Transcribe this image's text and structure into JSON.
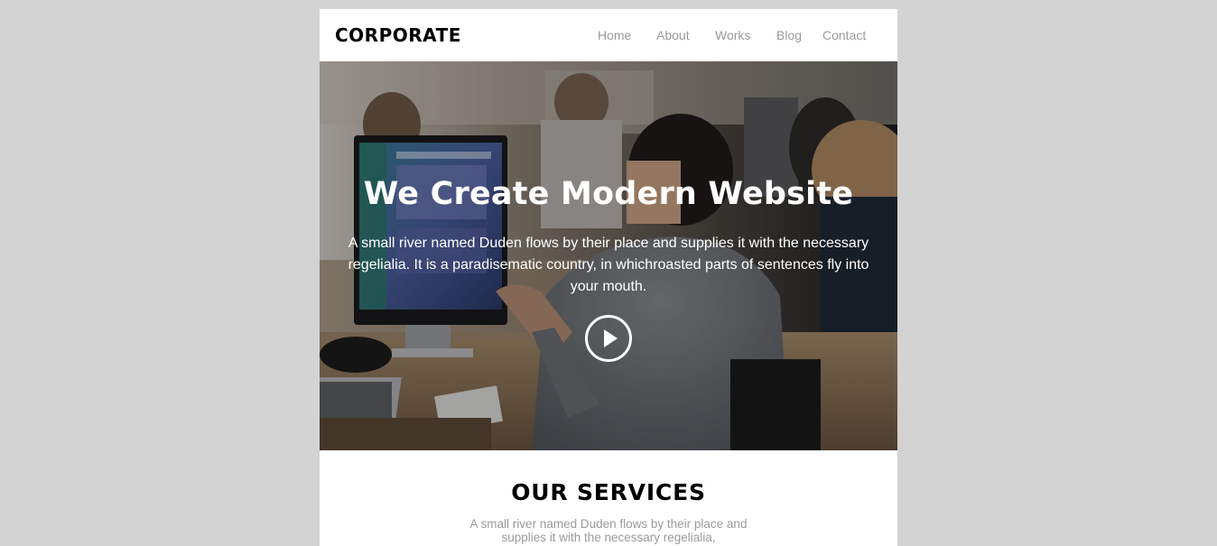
{
  "header": {
    "logo": "CORPORATE",
    "nav": [
      "Home",
      "About",
      "Works",
      "Blog",
      "Contact"
    ]
  },
  "hero": {
    "title": "We Create Modern Website",
    "text": "A small river named Duden flows by their place and supplies it with the necessary regelialia. It is a paradisematic country, in whichroasted parts of sentences fly into your mouth.",
    "play_icon": "play-circle-icon",
    "image": "office-people-working-at-computers-photo"
  },
  "services": {
    "title": "OUR SERVICES",
    "text": "A small river named Duden flows by their place and supplies it with the necessary regelialia,"
  },
  "colors": {
    "page_background": "#d3d3d3",
    "card_background": "#ffffff",
    "nav_text": "#9a9a9a",
    "hero_text": "#ffffff",
    "heading_text": "#000000"
  }
}
